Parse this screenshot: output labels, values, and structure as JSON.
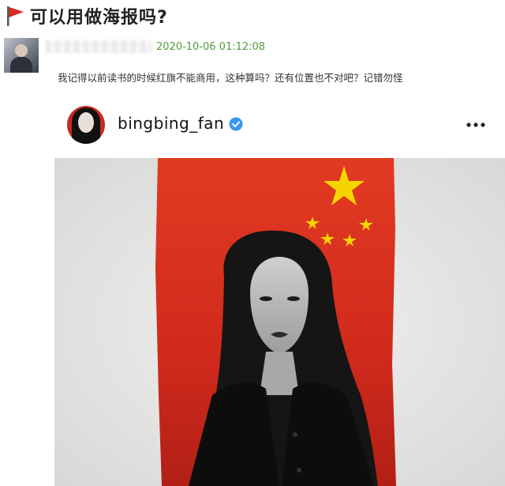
{
  "thread": {
    "title": "可以用做海报吗?"
  },
  "comment": {
    "timestamp": "2020-10-06 01:12:08",
    "text": "我记得以前读书的时候红旗不能商用，这种算吗？还有位置也不对吧？记错勿怪"
  },
  "post": {
    "username": "bingbing_fan",
    "verified_icon": "verified-icon",
    "more_icon": "more-icon"
  },
  "colors": {
    "timestamp": "#4f9a3a",
    "flag_red": "#d92a1f",
    "star_yellow": "#f5d400",
    "verified": "#3897f0"
  }
}
